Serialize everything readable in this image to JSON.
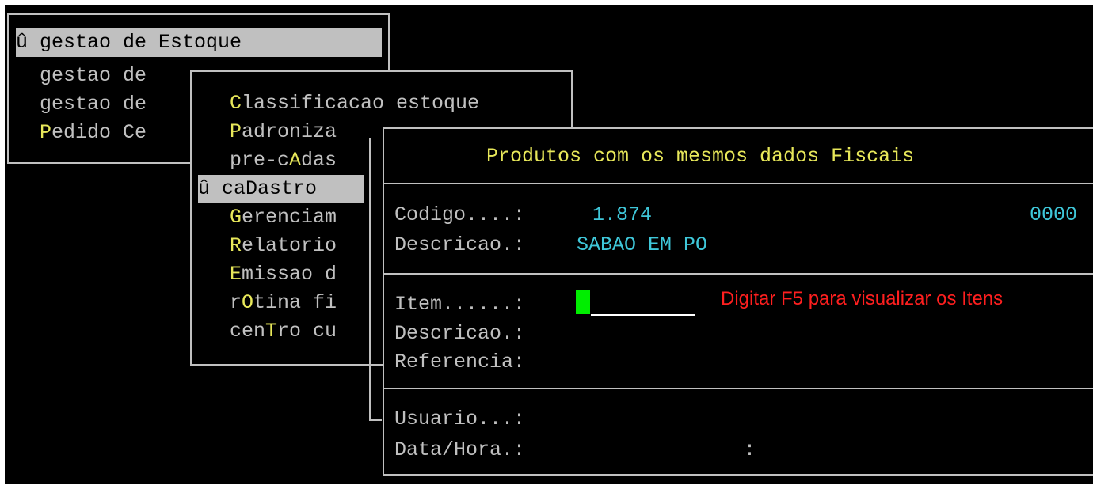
{
  "menu1": {
    "items": [
      {
        "marker": "û ",
        "label": "gestao de Estoque",
        "selected": true
      },
      {
        "pre": "  ",
        "hot": "",
        "rest": "gestao de"
      },
      {
        "pre": "  ",
        "hot": "",
        "rest": "gestao de"
      },
      {
        "pre": "  ",
        "hot": "P",
        "rest": "edido Ce"
      }
    ]
  },
  "menu2": {
    "items": [
      {
        "pre": "",
        "hot": "C",
        "rest": "lassificacao estoque"
      },
      {
        "pre": "",
        "hot": "P",
        "rest": "adroniza"
      },
      {
        "pre": "pre-c",
        "hot": "A",
        "rest": "das"
      },
      {
        "marker": "û ",
        "label": "caDastro",
        "selected": true
      },
      {
        "pre": "",
        "hot": "G",
        "rest": "erenciam"
      },
      {
        "pre": "",
        "hot": "R",
        "rest": "elatorio"
      },
      {
        "pre": "",
        "hot": "E",
        "rest": "missao d"
      },
      {
        "pre": "r",
        "hot": "O",
        "rest": "tina fi"
      },
      {
        "pre": "cen",
        "hot": "T",
        "rest": "ro cu"
      }
    ]
  },
  "dialog": {
    "title": "Produtos com os mesmos dados Fiscais",
    "codigo_label": "Codigo....:",
    "codigo_value": "1.874",
    "codigo_extra": "0000",
    "descricao_label": "Descricao.:",
    "descricao_value": "SABAO EM PO",
    "item_label": "Item......:",
    "item_value": "",
    "hint": "Digitar F5 para visualizar os Itens",
    "descricao2_label": "Descricao.:",
    "referencia_label": "Referencia:",
    "usuario_label": "Usuario...:",
    "datahora_label": "Data/Hora.:",
    "datahora_sep": ":"
  },
  "colors": {
    "hotkey": "#e8e85a",
    "value": "#3fc7d9",
    "hint": "#ff1f1f",
    "cursor": "#00ee00",
    "text": "#c0c0c0",
    "background": "#000000"
  }
}
